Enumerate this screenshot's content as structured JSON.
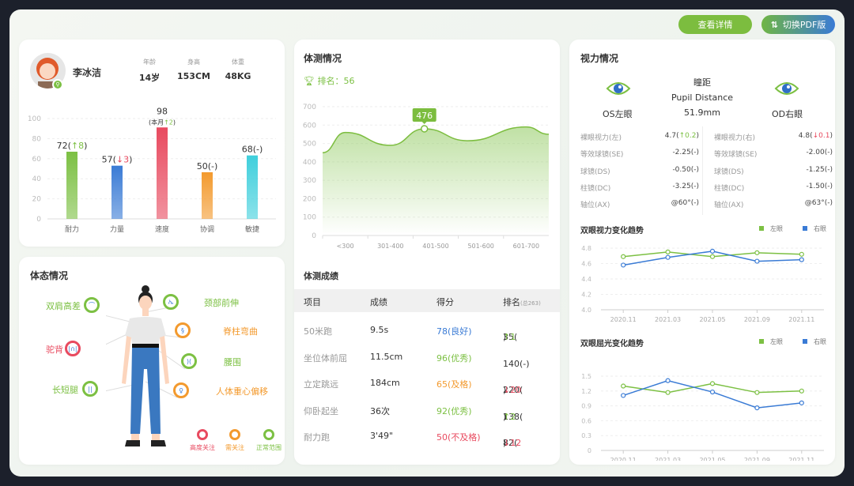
{
  "header": {
    "detail_button": "查看详情",
    "pdf_button": "切换PDF版"
  },
  "profile": {
    "name": "李冰洁",
    "stats": [
      {
        "label": "年龄",
        "value": "14岁"
      },
      {
        "label": "身高",
        "value": "153CM"
      },
      {
        "label": "体重",
        "value": "48KG"
      }
    ]
  },
  "colors": {
    "green": "#7cc043",
    "blue": "#3a7bd5",
    "red": "#e84a5f",
    "orange": "#f39a2e",
    "cyan": "#3fcfdc"
  },
  "chart_data": [
    {
      "type": "bar",
      "title": "",
      "categories": [
        "耐力",
        "力量",
        "速度",
        "协调",
        "敏捷"
      ],
      "values": [
        72,
        57,
        98,
        50,
        68
      ],
      "labels": [
        "72(",
        "57(",
        "98",
        "50(-)",
        "68(-)"
      ],
      "changes": [
        "↑8",
        "↓3",
        "",
        "",
        ""
      ],
      "sub_label": {
        "prefix": "(本月",
        "change": "↑2",
        "suffix": ")"
      },
      "ylim": [
        0,
        100
      ],
      "yticks": [
        0,
        20,
        40,
        60,
        80,
        100
      ],
      "colors": [
        "#7cc043",
        "#3a7bd5",
        "#e84a5f",
        "#f39a2e",
        "#3fcfdc"
      ]
    },
    {
      "type": "area",
      "title": "体测情况",
      "categories": [
        "<300",
        "301-400",
        "401-500",
        "501-600",
        "601-700"
      ],
      "x": [
        -0.5,
        0,
        1,
        1.75,
        2.7,
        4,
        4.5
      ],
      "values": [
        450,
        560,
        490,
        580,
        515,
        590,
        550
      ],
      "ylim": [
        0,
        700
      ],
      "yticks": [
        0,
        100,
        200,
        300,
        400,
        500,
        600,
        700
      ],
      "highlight": {
        "x": 1.75,
        "y": 580,
        "label": "476"
      }
    },
    {
      "type": "line",
      "title": "双眼视力变化趋势",
      "categories": [
        "2020.11",
        "2021.03",
        "2021.05",
        "2021.09",
        "2021.11"
      ],
      "series": [
        {
          "name": "左眼",
          "values": [
            4.69,
            4.75,
            4.69,
            4.74,
            4.72
          ]
        },
        {
          "name": "右眼",
          "values": [
            4.58,
            4.68,
            4.76,
            4.63,
            4.65
          ]
        }
      ],
      "ylim": [
        4.0,
        4.8
      ],
      "yticks": [
        "4.0",
        "4.2",
        "4.4",
        "4.6",
        "4.8"
      ]
    },
    {
      "type": "line",
      "title": "双眼屈光变化趋势",
      "categories": [
        "2020.11",
        "2021.03",
        "2021.05",
        "2021.09",
        "2021.11"
      ],
      "series": [
        {
          "name": "左眼",
          "values": [
            1.3,
            1.17,
            1.35,
            1.17,
            1.2
          ]
        },
        {
          "name": "右眼",
          "values": [
            1.11,
            1.41,
            1.18,
            0.86,
            0.96
          ]
        }
      ],
      "ylim": [
        0,
        1.5
      ],
      "yticks": [
        "0",
        "0.3",
        "0.6",
        "0.9",
        "1.2",
        "1.5"
      ]
    }
  ],
  "fitness": {
    "title": "体测情况",
    "rank_label": "排名：56",
    "scores_title": "体测成绩",
    "columns": [
      "项目",
      "成绩",
      "得分",
      "排名"
    ],
    "rank_total": "(总263)",
    "rows": [
      {
        "item": "50米跑",
        "result": "9.5s",
        "score": "78(良好)",
        "score_color": "b",
        "rank": "35(",
        "change": "↑1",
        "change_color": "g",
        "rank_end": ")"
      },
      {
        "item": "坐位体前屈",
        "result": "11.5cm",
        "score": "96(优秀)",
        "score_color": "g",
        "rank": "140(-)",
        "change": "",
        "change_color": "",
        "rank_end": ""
      },
      {
        "item": "立定跳远",
        "result": "184cm",
        "score": "65(及格)",
        "score_color": "o",
        "rank": "220(",
        "change": "↓20",
        "change_color": "r",
        "rank_end": ")"
      },
      {
        "item": "仰卧起坐",
        "result": "36次",
        "score": "92(优秀)",
        "score_color": "g",
        "rank": "138(",
        "change": "↑2",
        "change_color": "g",
        "rank_end": ")"
      },
      {
        "item": "耐力跑",
        "result": "3'49\"",
        "score": "50(不及格)",
        "score_color": "r",
        "rank": "82(",
        "change": "↓12",
        "change_color": "r",
        "rank_end": ")"
      }
    ]
  },
  "posture": {
    "title": "体态情况",
    "items": [
      {
        "label": "双肩高差",
        "status": "g",
        "glyph": "⌒"
      },
      {
        "label": "颈部前伸",
        "status": "g",
        "glyph": "ኢ"
      },
      {
        "label": "驼背",
        "status": "r",
        "glyph": "|∩|"
      },
      {
        "label": "脊柱弯曲",
        "status": "o",
        "glyph": "§"
      },
      {
        "label": "腰围",
        "status": "g",
        "glyph": ")("
      },
      {
        "label": "长短腿",
        "status": "g",
        "glyph": "||"
      },
      {
        "label": "人体重心偏移",
        "status": "o",
        "glyph": "♀"
      }
    ],
    "legend": [
      {
        "label": "高度关注",
        "status": "r"
      },
      {
        "label": "需关注",
        "status": "o"
      },
      {
        "label": "正常范围",
        "status": "g"
      }
    ]
  },
  "vision": {
    "title": "视力情况",
    "left_eye": "OS左眼",
    "right_eye": "OD右眼",
    "pd_title": "瞳距",
    "pd_subtitle": "Pupil Distance",
    "pd_value": "51.9mm",
    "left": [
      {
        "k": "裸眼视力(左)",
        "v": "4.7(",
        "c": "↑0.2",
        "cc": "g",
        "e": ")"
      },
      {
        "k": "等效球镜(SE)",
        "v": "-2.25(-)"
      },
      {
        "k": "球镜(DS)",
        "v": "-0.50(-)"
      },
      {
        "k": "柱镜(DC)",
        "v": "-3.25(-)"
      },
      {
        "k": "轴位(AX)",
        "v": "@60°(-)"
      }
    ],
    "right": [
      {
        "k": "裸眼视力(右)",
        "v": "4.8(",
        "c": "↓0.1",
        "cc": "r",
        "e": ")"
      },
      {
        "k": "等效球镜(SE)",
        "v": "-2.00(-)"
      },
      {
        "k": "球镜(DS)",
        "v": "-1.25(-)"
      },
      {
        "k": "柱镜(DC)",
        "v": "-1.50(-)"
      },
      {
        "k": "轴位(AX)",
        "v": "@63°(-)"
      }
    ]
  }
}
